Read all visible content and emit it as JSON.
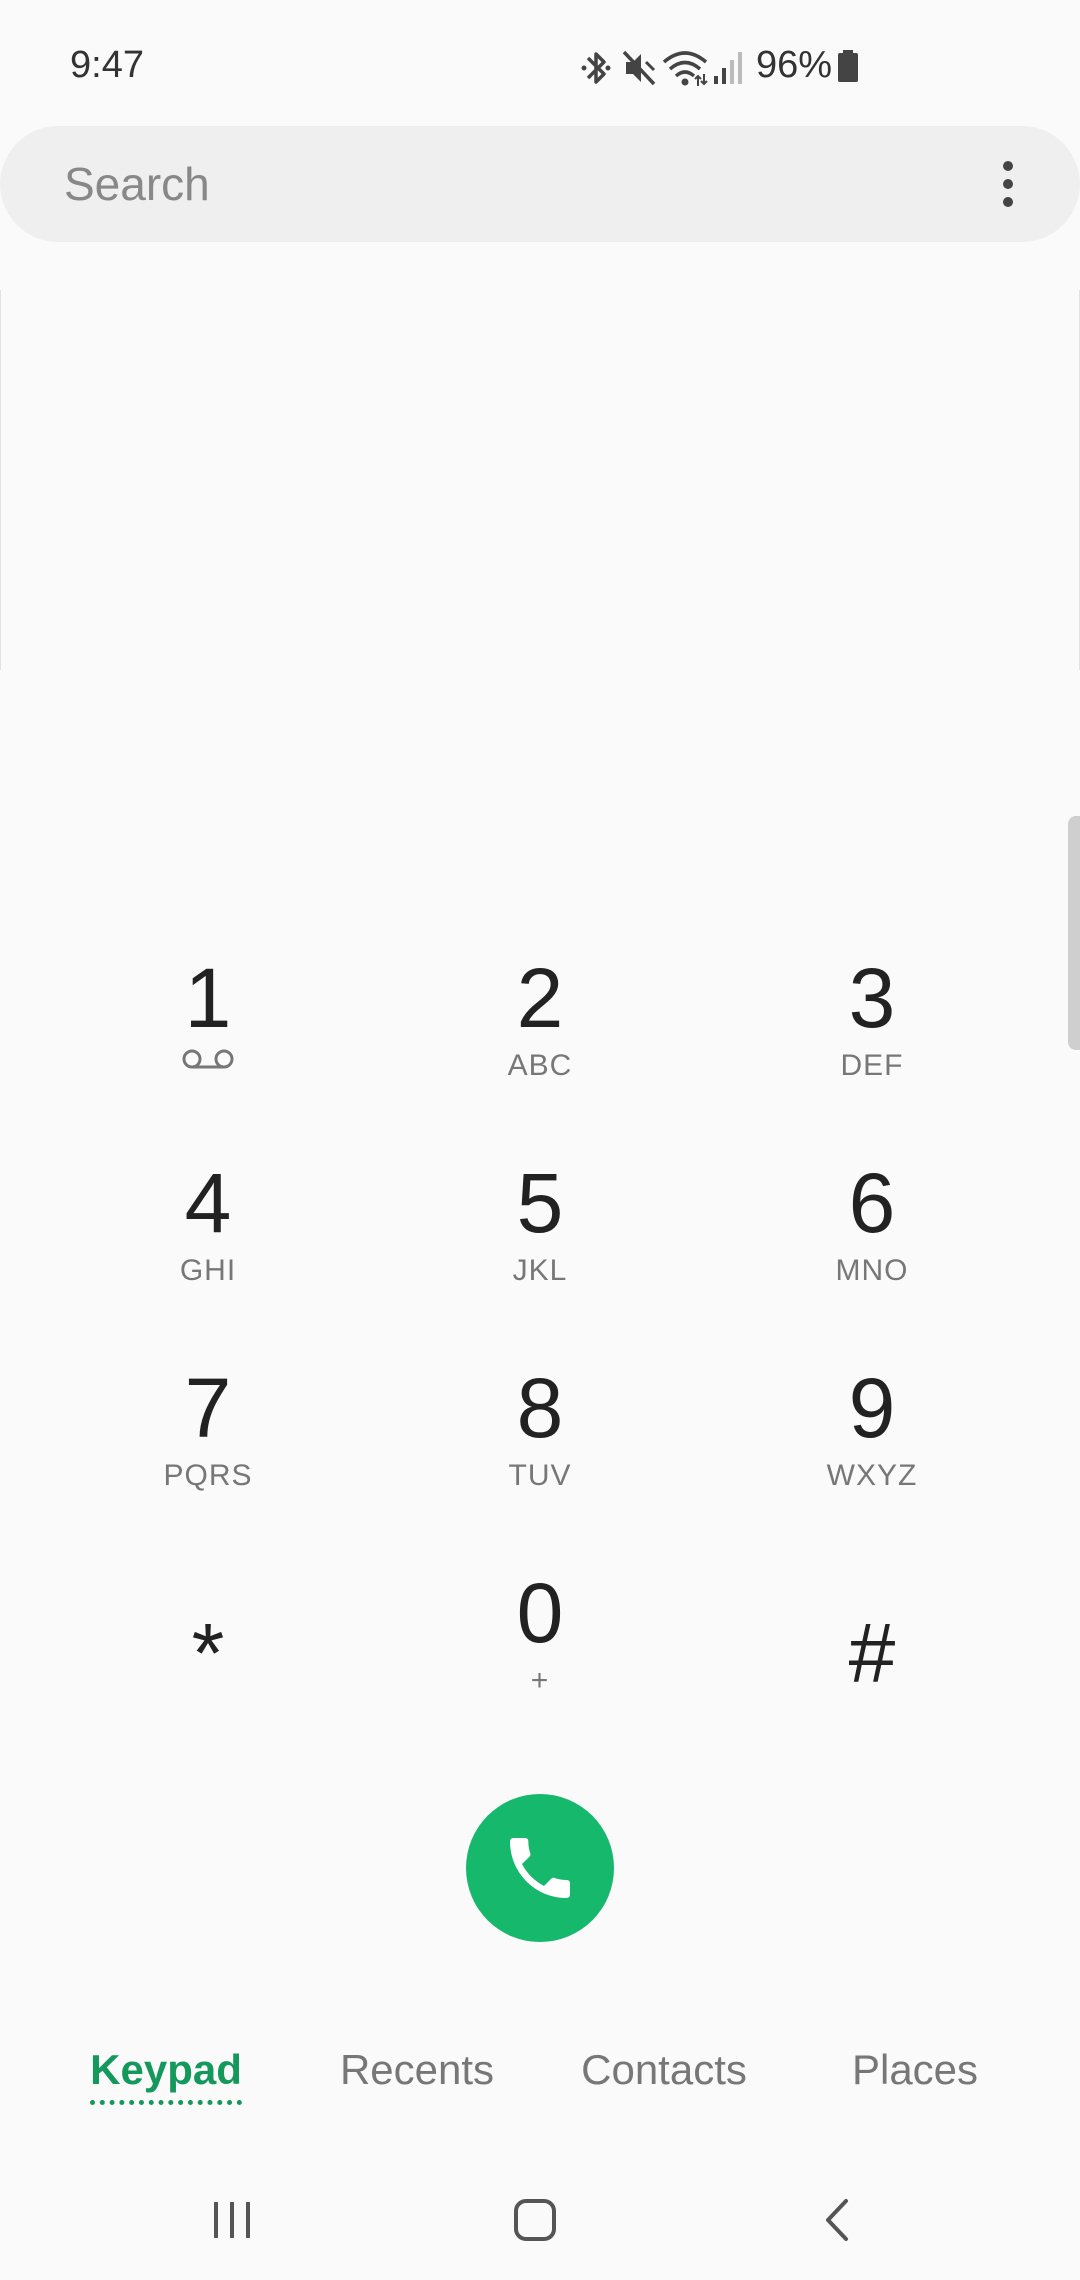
{
  "status_bar": {
    "time": "9:47",
    "battery": "96%",
    "icons": [
      "bluetooth-icon",
      "mute-icon",
      "wifi-icon",
      "signal-icon",
      "battery-icon"
    ]
  },
  "search": {
    "placeholder": "Search",
    "value": ""
  },
  "keypad": {
    "keys": [
      {
        "digit": "1",
        "letters": ""
      },
      {
        "digit": "2",
        "letters": "ABC"
      },
      {
        "digit": "3",
        "letters": "DEF"
      },
      {
        "digit": "4",
        "letters": "GHI"
      },
      {
        "digit": "5",
        "letters": "JKL"
      },
      {
        "digit": "6",
        "letters": "MNO"
      },
      {
        "digit": "7",
        "letters": "PQRS"
      },
      {
        "digit": "8",
        "letters": "TUV"
      },
      {
        "digit": "9",
        "letters": "WXYZ"
      },
      {
        "digit": "*",
        "letters": ""
      },
      {
        "digit": "0",
        "letters": "+"
      },
      {
        "digit": "#",
        "letters": ""
      }
    ]
  },
  "call_button": {
    "icon": "phone-icon",
    "color": "#16b86b"
  },
  "tabs": [
    {
      "label": "Keypad",
      "active": true
    },
    {
      "label": "Recents",
      "active": false
    },
    {
      "label": "Contacts",
      "active": false
    },
    {
      "label": "Places",
      "active": false
    }
  ],
  "colors": {
    "accent": "#15985c",
    "call": "#16b86b"
  }
}
